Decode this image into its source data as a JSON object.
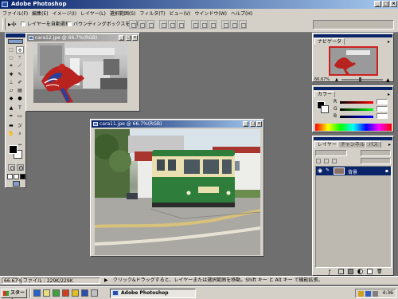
{
  "window": {
    "title": "Adobe Photoshop",
    "controls": [
      "_",
      "□",
      "×"
    ]
  },
  "menu": [
    "ファイル(F)",
    "編集(E)",
    "イメージ(I)",
    "レイヤー(L)",
    "選択範囲(S)",
    "フィルタ(T)",
    "ビュー(V)",
    "ウインドウ(W)",
    "ヘルプ(H)"
  ],
  "options": {
    "auto_select_layer": "レイヤーを自動選択",
    "show_bounding_box": "バウンディングボックスを表示"
  },
  "documents": [
    {
      "title": "cara12.jpe @ 66.7%(RGB)"
    },
    {
      "title": "cara11.jpe @ 66.7%(RGB)"
    }
  ],
  "navigator": {
    "tab": "ナビゲータ",
    "zoom": "66.67%"
  },
  "color_panel": {
    "tab": "カラー",
    "channels": [
      "R",
      "G",
      "B"
    ]
  },
  "layers_panel": {
    "tabs": [
      "レイヤー",
      "チャンネル",
      "パス"
    ],
    "layer_name": "背景"
  },
  "status": {
    "zoom": "66.67%",
    "file_size": "ファイル : 229K/229K",
    "hint": "クリック&ドラッグすると、レイヤーまたは選択範囲を移動。Shift キー と Alt キー で機能拡張。"
  },
  "taskbar": {
    "start": "スタート",
    "task": "Adobe Photoshop",
    "clock": "4:36"
  },
  "colors": {
    "workspace": "#6f6f6f",
    "titlebar_active": "#0a246a",
    "chrome": "#d4d0c8",
    "tram_green": "#2f7d3a",
    "tram_cream": "#e9dfb0"
  }
}
